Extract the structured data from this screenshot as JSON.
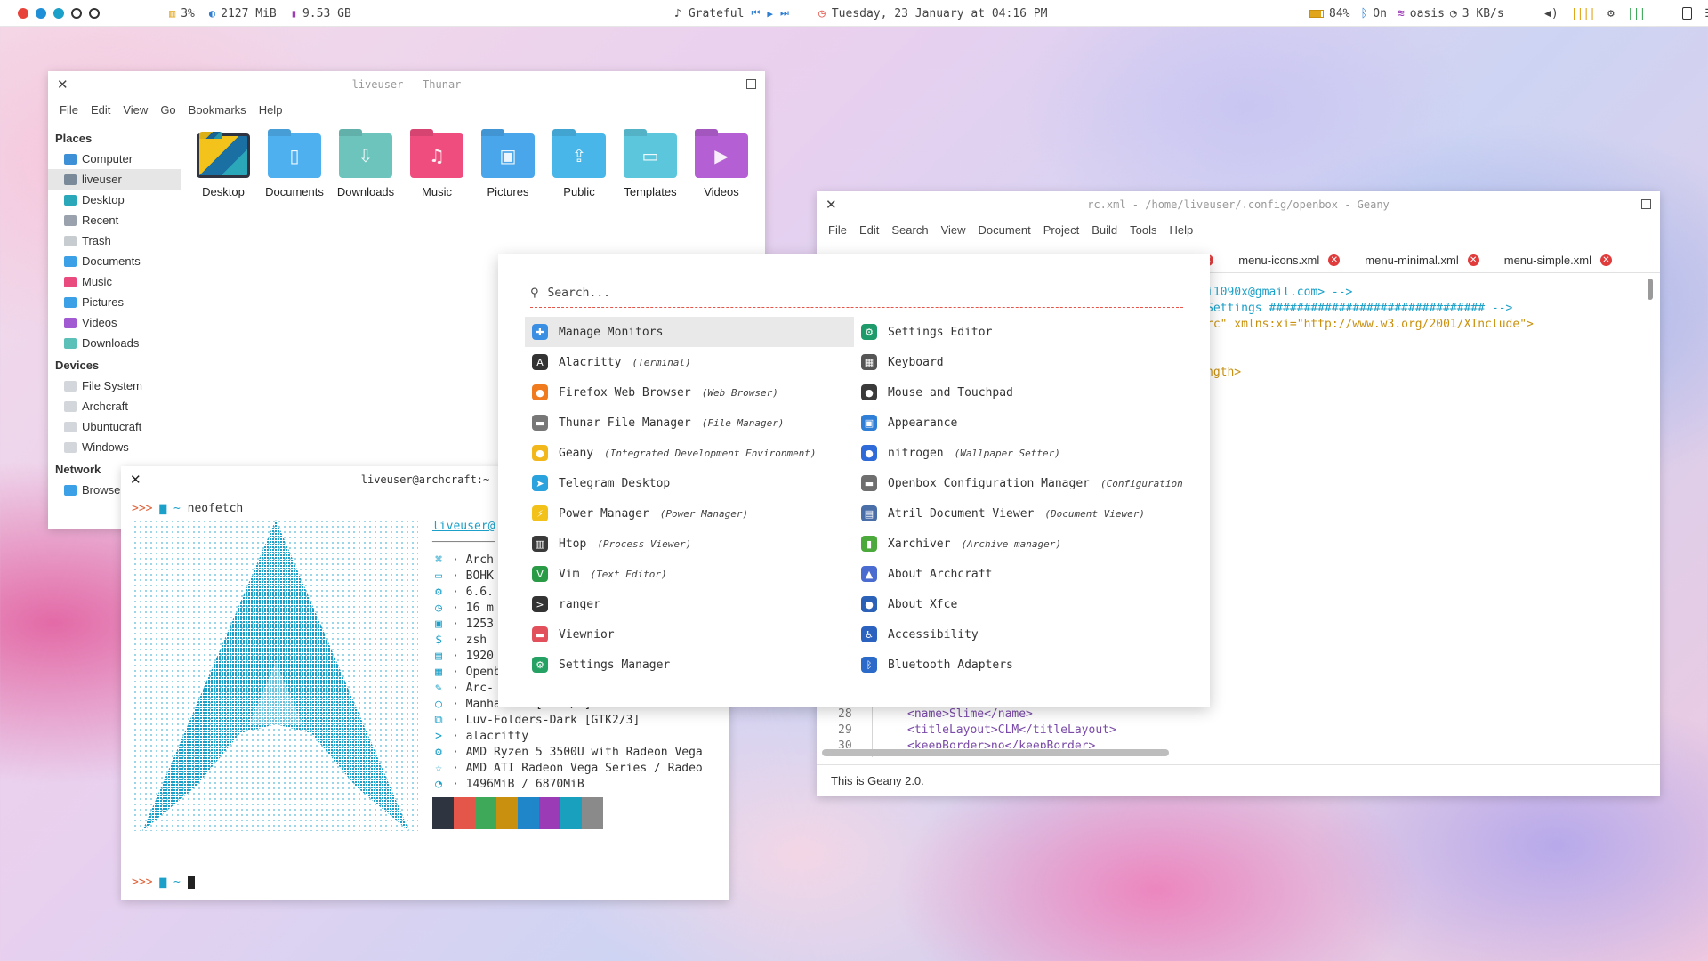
{
  "topbar": {
    "workspace_dot_colors": [
      "#e8433a",
      "#1f8fd8",
      "#1aa0c9"
    ],
    "cpu": "3%",
    "ram": "2127 MiB",
    "disk": "9.53 GB",
    "music_track": "Grateful",
    "media_controls": [
      "⏮",
      "▶",
      "⏭"
    ],
    "datetime": "Tuesday, 23 January at 04:16 PM",
    "battery": "84%",
    "bluetooth": "On",
    "wifi": "oasis",
    "net_speed": "3 KB/s"
  },
  "thunar": {
    "title": "liveuser - Thunar",
    "menu": [
      "File",
      "Edit",
      "View",
      "Go",
      "Bookmarks",
      "Help"
    ],
    "places_heading": "Places",
    "places": [
      {
        "label": "Computer",
        "color": "#3d8fd6"
      },
      {
        "label": "liveuser",
        "color": "#7a8a99"
      },
      {
        "label": "Desktop",
        "color": "#2aa8b9"
      },
      {
        "label": "Recent",
        "color": "#9aa3ad"
      },
      {
        "label": "Trash",
        "color": "#c7ccd1"
      },
      {
        "label": "Documents",
        "color": "#3ba0e6"
      },
      {
        "label": "Music",
        "color": "#e94b7f"
      },
      {
        "label": "Pictures",
        "color": "#3ba0e6"
      },
      {
        "label": "Videos",
        "color": "#a15ad1"
      },
      {
        "label": "Downloads",
        "color": "#5bc0b8"
      }
    ],
    "devices_heading": "Devices",
    "devices": [
      "File System",
      "Archcraft",
      "Ubuntucraft",
      "Windows"
    ],
    "network_heading": "Network",
    "network": [
      "Browse"
    ],
    "folders": [
      {
        "label": "Desktop",
        "color": "#1a6fa3",
        "icon": "◣"
      },
      {
        "label": "Documents",
        "color": "#4fb0ef",
        "icon": "▯"
      },
      {
        "label": "Downloads",
        "color": "#6cc4bd",
        "icon": "⇩"
      },
      {
        "label": "Music",
        "color": "#ee4d7e",
        "icon": "♫"
      },
      {
        "label": "Pictures",
        "color": "#49a6ea",
        "icon": "▣"
      },
      {
        "label": "Public",
        "color": "#48b6e8",
        "icon": "⇪"
      },
      {
        "label": "Templates",
        "color": "#5cc6dc",
        "icon": "▭"
      },
      {
        "label": "Videos",
        "color": "#b45fd3",
        "icon": "▶"
      }
    ]
  },
  "geany": {
    "title": "rc.xml - /home/liveuser/.config/openbox - Geany",
    "menu": [
      "File",
      "Edit",
      "Search",
      "View",
      "Document",
      "Project",
      "Build",
      "Tools",
      "Help"
    ],
    "tabs": [
      "menu-icons.xml",
      "menu-minimal.xml",
      "menu-simple.xml"
    ],
    "code_visible": [
      "i1090x@gmail.com> -->",
      "Settings ############################### -->",
      "rc\" xmlns:xi=\"http://www.w3.org/2001/XInclude\">",
      "ngth>"
    ],
    "line_28_num": "28",
    "line_28": "<name>Slime</name>",
    "line_29_num": "29",
    "line_29": "<titleLayout>CLM</titleLayout>",
    "line_30_num": "30",
    "line_30": "<keepBorder>no</keepBorder>",
    "status": "This is Geany 2.0."
  },
  "terminal": {
    "title": "liveuser@archcraft:~",
    "prompt": ">>>",
    "home": "~",
    "command": "neofetch",
    "user_host": "liveuser@",
    "separator": "─────────",
    "info": [
      {
        "icon": "⌘",
        "text": "· Arch"
      },
      {
        "icon": "▭",
        "text": "· BOHK"
      },
      {
        "icon": "⚙",
        "text": "· 6.6."
      },
      {
        "icon": "◷",
        "text": "· 16 m"
      },
      {
        "icon": "▣",
        "text": "· 1253"
      },
      {
        "icon": "$",
        "text": "· zsh"
      },
      {
        "icon": "▤",
        "text": "· 1920"
      },
      {
        "icon": "▦",
        "text": "· Openb"
      },
      {
        "icon": "✎",
        "text": "· Arc-"
      },
      {
        "icon": "○",
        "text": "· Manhattan [GTK2/3]"
      },
      {
        "icon": "⧉",
        "text": "· Luv-Folders-Dark [GTK2/3]"
      },
      {
        "icon": ">",
        "text": "· alacritty"
      },
      {
        "icon": "⚙",
        "text": "· AMD Ryzen 5 3500U with Radeon Vega"
      },
      {
        "icon": "☆",
        "text": "· AMD ATI Radeon Vega Series / Radeo"
      },
      {
        "icon": "◔",
        "text": "· 1496MiB / 6870MiB"
      }
    ],
    "palette": [
      "#2e3440",
      "#e4554a",
      "#3fa95a",
      "#c8900e",
      "#1f86c9",
      "#9b3bb5",
      "#1aa0bf",
      "#8a8a8a"
    ]
  },
  "launcher": {
    "search_placeholder": "Search...",
    "left": [
      {
        "name": "Manage Monitors",
        "desc": "",
        "icon_color": "#3b8fe3",
        "glyph": "✚"
      },
      {
        "name": "Alacritty",
        "desc": "(Terminal)",
        "icon_color": "#333333",
        "glyph": "A"
      },
      {
        "name": "Firefox Web Browser",
        "desc": "(Web Browser)",
        "icon_color": "#f07a1e",
        "glyph": "●"
      },
      {
        "name": "Thunar File Manager",
        "desc": "(File Manager)",
        "icon_color": "#777777",
        "glyph": "▬"
      },
      {
        "name": "Geany",
        "desc": "(Integrated Development Environment)",
        "icon_color": "#f2b81b",
        "glyph": "●"
      },
      {
        "name": "Telegram Desktop",
        "desc": "",
        "icon_color": "#2aa2dd",
        "glyph": "➤"
      },
      {
        "name": "Power Manager",
        "desc": "(Power Manager)",
        "icon_color": "#f2c21b",
        "glyph": "⚡"
      },
      {
        "name": "Htop",
        "desc": "(Process Viewer)",
        "icon_color": "#3a3a3a",
        "glyph": "▥"
      },
      {
        "name": "Vim",
        "desc": "(Text Editor)",
        "icon_color": "#2b9a46",
        "glyph": "V"
      },
      {
        "name": "ranger",
        "desc": "",
        "icon_color": "#333333",
        "glyph": ">"
      },
      {
        "name": "Viewnior",
        "desc": "",
        "icon_color": "#e2505c",
        "glyph": "▬"
      },
      {
        "name": "Settings Manager",
        "desc": "",
        "icon_color": "#25a163",
        "glyph": "⚙"
      }
    ],
    "right": [
      {
        "name": "Settings Editor",
        "desc": "",
        "icon_color": "#1f9a6a",
        "glyph": "⚙"
      },
      {
        "name": "Keyboard",
        "desc": "",
        "icon_color": "#555555",
        "glyph": "▦"
      },
      {
        "name": "Mouse and Touchpad",
        "desc": "",
        "icon_color": "#3a3a3a",
        "glyph": "●"
      },
      {
        "name": "Appearance",
        "desc": "",
        "icon_color": "#2f7fd6",
        "glyph": "▣"
      },
      {
        "name": "nitrogen",
        "desc": "(Wallpaper Setter)",
        "icon_color": "#2e6ad8",
        "glyph": "●"
      },
      {
        "name": "Openbox Configuration Manager",
        "desc": "(Configuration Ma...",
        "icon_color": "#6f6f6f",
        "glyph": "▬"
      },
      {
        "name": "Atril Document Viewer",
        "desc": "(Document Viewer)",
        "icon_color": "#4a6ea8",
        "glyph": "▤"
      },
      {
        "name": "Xarchiver",
        "desc": "(Archive manager)",
        "icon_color": "#4caa3c",
        "glyph": "▮"
      },
      {
        "name": "About Archcraft",
        "desc": "",
        "icon_color": "#4a6bd0",
        "glyph": "▲"
      },
      {
        "name": "About Xfce",
        "desc": "",
        "icon_color": "#2b62b8",
        "glyph": "●"
      },
      {
        "name": "Accessibility",
        "desc": "",
        "icon_color": "#2b62c0",
        "glyph": "♿"
      },
      {
        "name": "Bluetooth Adapters",
        "desc": "",
        "icon_color": "#2b6ac8",
        "glyph": "ᛒ"
      }
    ]
  }
}
